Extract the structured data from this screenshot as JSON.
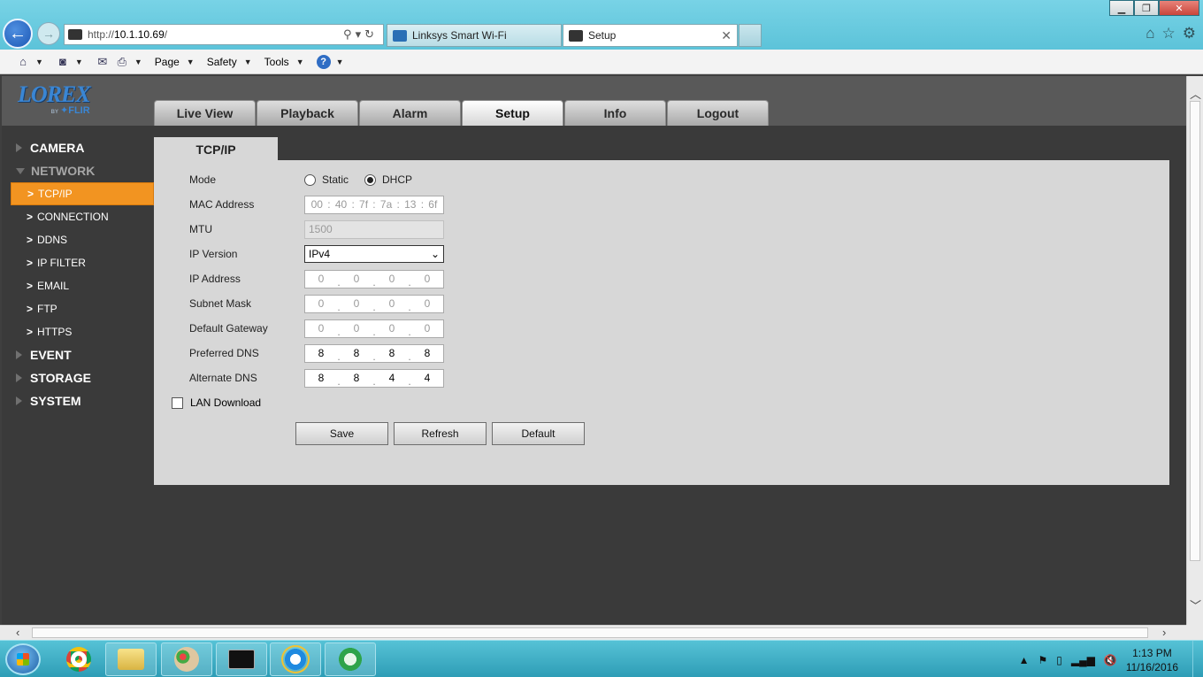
{
  "browser": {
    "address_prefix": "http://",
    "address_host": "10.1.10.69",
    "address_suffix": "/",
    "tabs": [
      {
        "label": "Linksys Smart Wi-Fi"
      },
      {
        "label": "Setup"
      }
    ],
    "command_bar": {
      "page": "Page",
      "safety": "Safety",
      "tools": "Tools",
      "help": "?"
    }
  },
  "app": {
    "logo_main": "LOREX",
    "logo_by": "BY",
    "logo_sub": "FLIR",
    "main_tabs": [
      "Live View",
      "Playback",
      "Alarm",
      "Setup",
      "Info",
      "Logout"
    ],
    "active_tab": "Setup"
  },
  "sidebar": {
    "camera": "CAMERA",
    "network": "NETWORK",
    "network_items": [
      "TCP/IP",
      "CONNECTION",
      "DDNS",
      "IP FILTER",
      "EMAIL",
      "FTP",
      "HTTPS"
    ],
    "event": "EVENT",
    "storage": "STORAGE",
    "system": "SYSTEM"
  },
  "form": {
    "tab_title": "TCP/IP",
    "mode_label": "Mode",
    "mode_static": "Static",
    "mode_dhcp": "DHCP",
    "mode_selected": "DHCP",
    "mac_label": "MAC Address",
    "mac": [
      "00",
      "40",
      "7f",
      "7a",
      "13",
      "6f"
    ],
    "mtu_label": "MTU",
    "mtu": "1500",
    "ipver_label": "IP Version",
    "ipver": "IPv4",
    "ip_label": "IP Address",
    "ip": [
      "0",
      "0",
      "0",
      "0"
    ],
    "subnet_label": "Subnet Mask",
    "subnet": [
      "0",
      "0",
      "0",
      "0"
    ],
    "gateway_label": "Default Gateway",
    "gateway": [
      "0",
      "0",
      "0",
      "0"
    ],
    "dns1_label": "Preferred DNS",
    "dns1": [
      "8",
      "8",
      "8",
      "8"
    ],
    "dns2_label": "Alternate DNS",
    "dns2": [
      "8",
      "8",
      "4",
      "4"
    ],
    "lan_download_label": "LAN Download",
    "lan_download_checked": false,
    "save": "Save",
    "refresh": "Refresh",
    "default": "Default"
  },
  "taskbar": {
    "time": "1:13 PM",
    "date": "11/16/2016"
  },
  "colors": {
    "accent_orange": "#f29421",
    "logo_blue": "#3a86d4",
    "panel_gray": "#d7d7d7",
    "page_dark": "#3a3a3a"
  }
}
